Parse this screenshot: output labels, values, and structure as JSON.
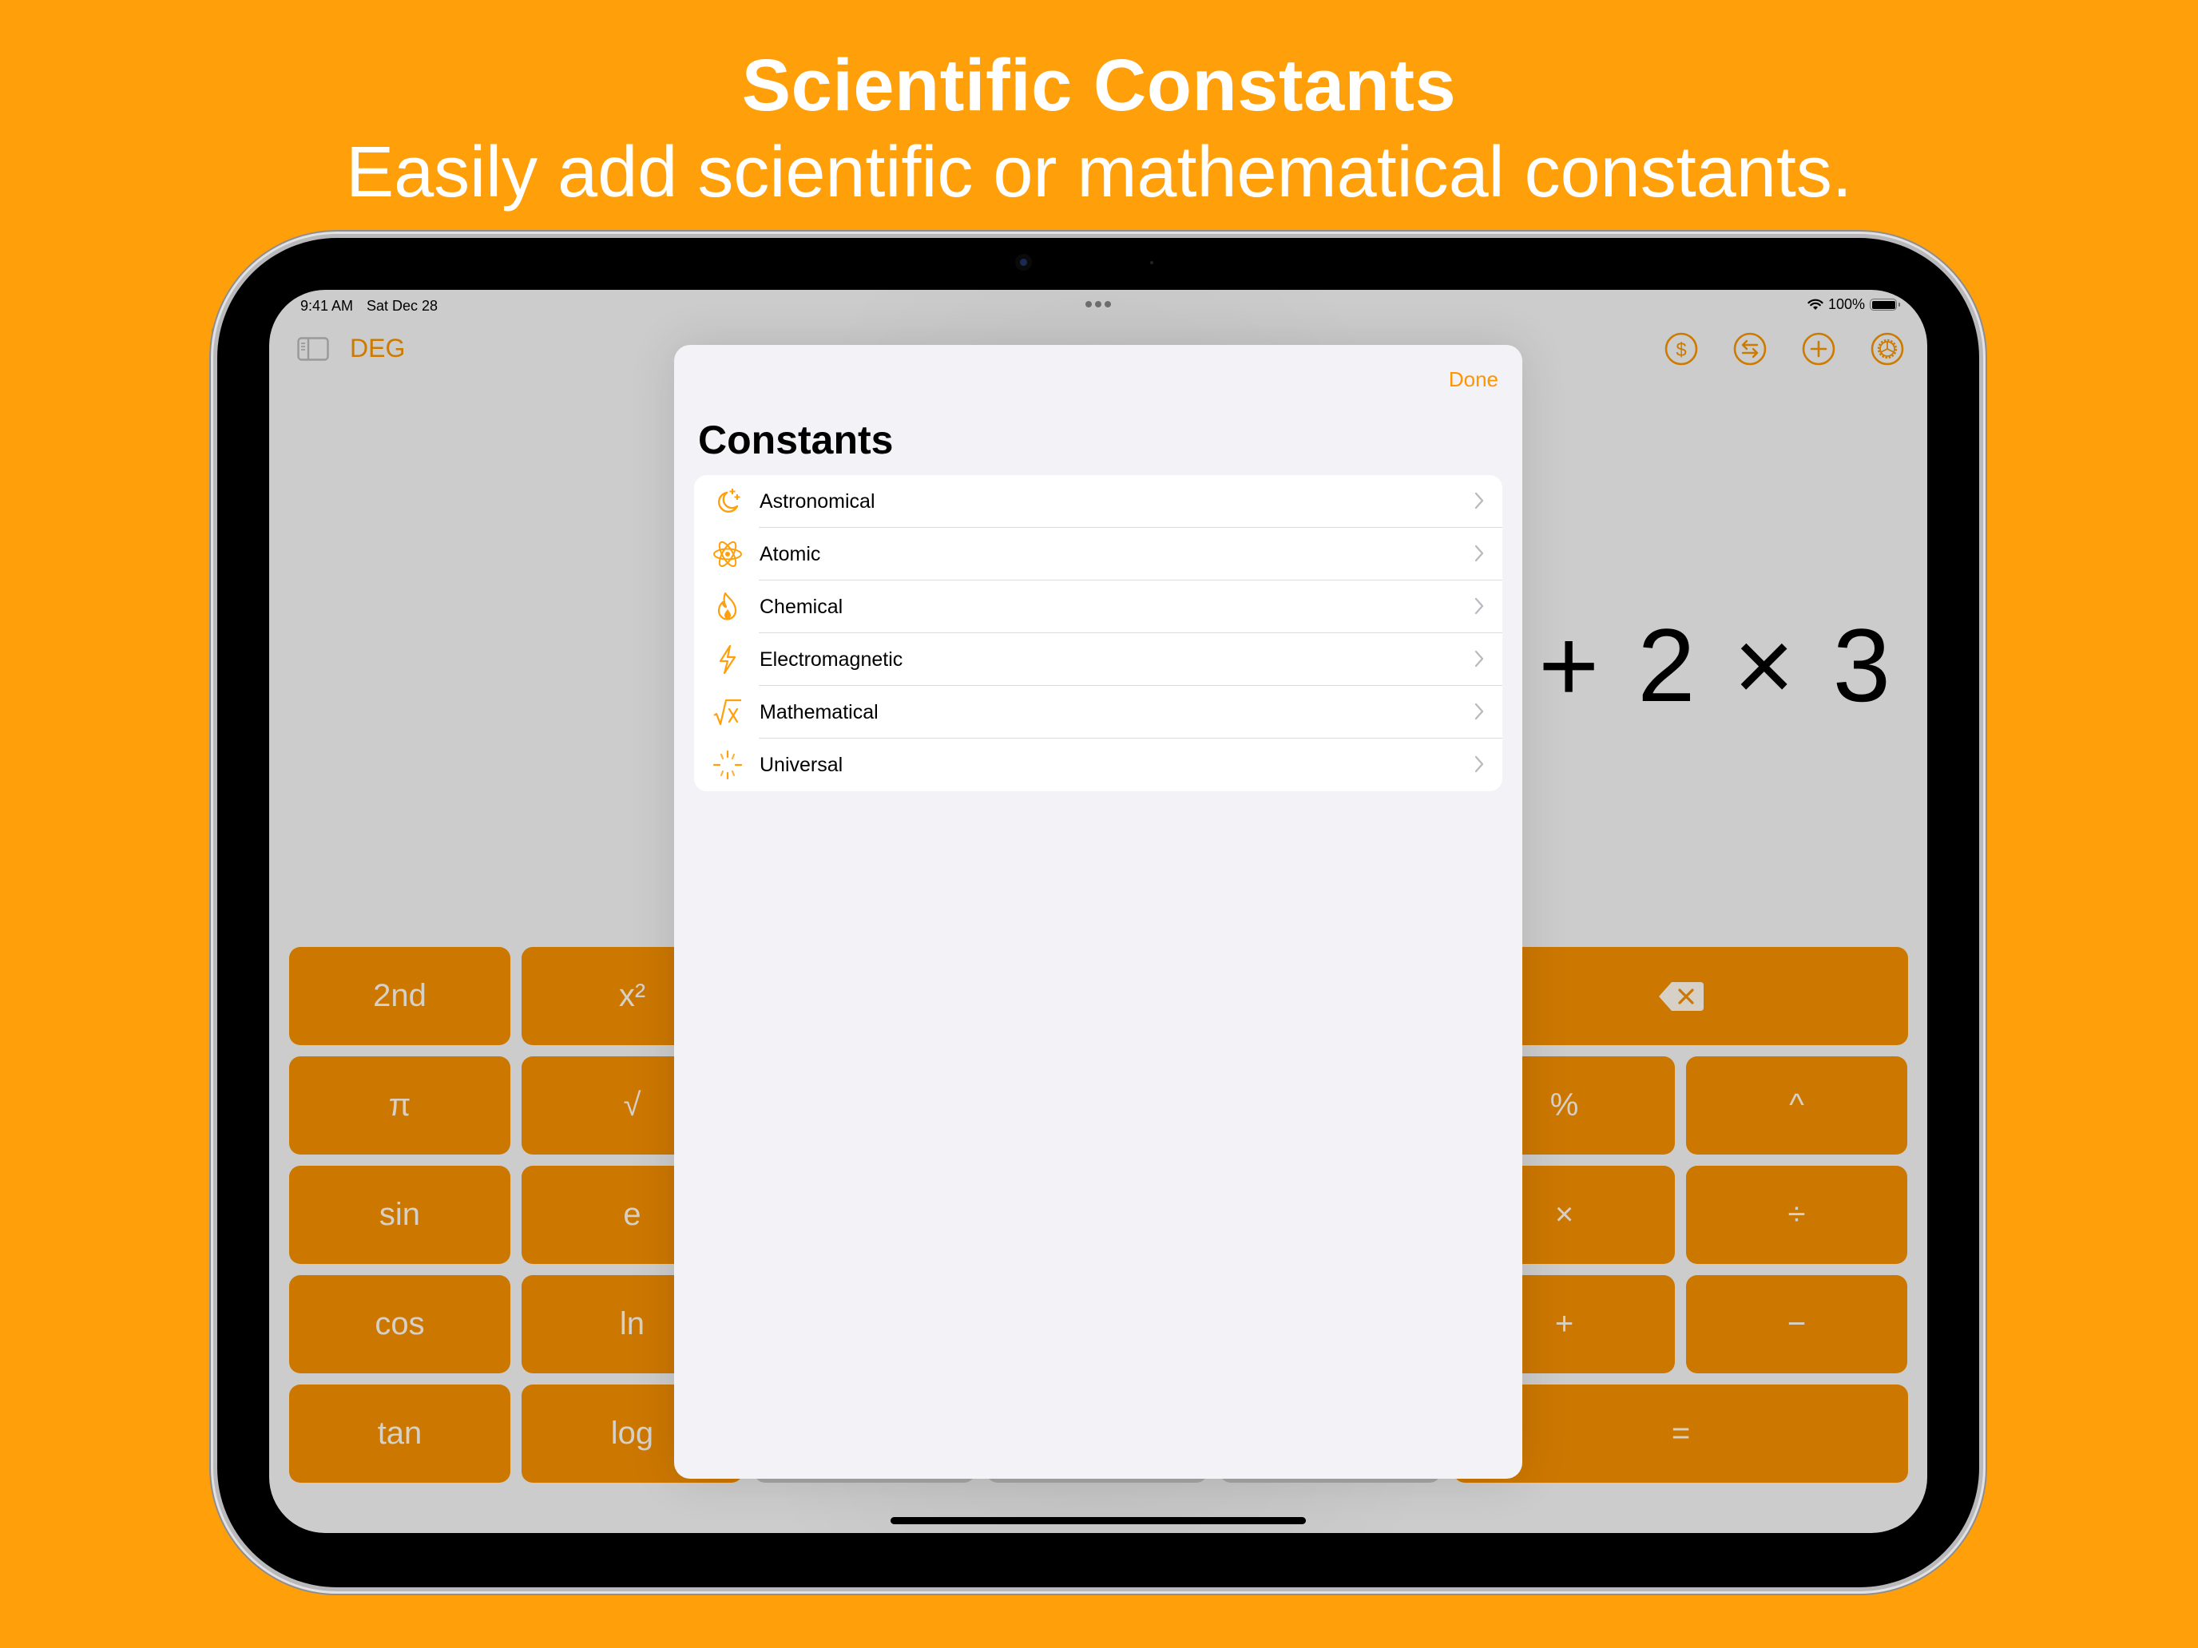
{
  "headline": {
    "title": "Scientific Constants",
    "subtitle": "Easily add scientific or mathematical constants."
  },
  "status_bar": {
    "time": "9:41 AM",
    "date": "Sat Dec 28",
    "battery": "100%",
    "wifi_icon": "wifi-icon",
    "battery_icon": "battery-full-icon"
  },
  "toolbar": {
    "sidebar_icon": "sidebar-toggle-icon",
    "angle_mode": "DEG",
    "right_icons": [
      "currency-icon",
      "convert-icon",
      "add-icon",
      "settings-icon"
    ]
  },
  "display": {
    "expression": "1 + 2 × 3"
  },
  "keypad": {
    "left_keys": [
      [
        "2nd",
        "x²"
      ],
      [
        "π",
        "√"
      ],
      [
        "sin",
        "e"
      ],
      [
        "cos",
        "ln"
      ],
      [
        "tan",
        "log"
      ]
    ],
    "right_keys": {
      "backspace_icon": "backspace-icon",
      "rows": [
        [
          "%",
          "^"
        ],
        [
          "×",
          "÷"
        ],
        [
          "+",
          "−"
        ]
      ],
      "equals": "="
    }
  },
  "modal": {
    "done_label": "Done",
    "title": "Constants",
    "categories": [
      {
        "label": "Astronomical",
        "icon": "moon-stars-icon"
      },
      {
        "label": "Atomic",
        "icon": "atom-icon"
      },
      {
        "label": "Chemical",
        "icon": "flame-icon"
      },
      {
        "label": "Electromagnetic",
        "icon": "bolt-icon"
      },
      {
        "label": "Mathematical",
        "icon": "square-root-icon"
      },
      {
        "label": "Universal",
        "icon": "rays-icon"
      }
    ]
  },
  "colors": {
    "background": "#ff9f0a",
    "accent": "#ff9500",
    "key_orange": "#cc7700",
    "screen_bg": "#cccccc",
    "modal_bg": "#f2f2f7"
  }
}
